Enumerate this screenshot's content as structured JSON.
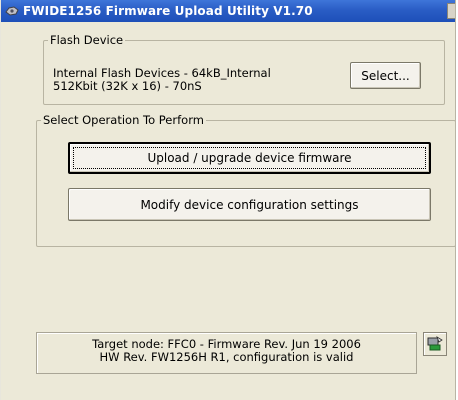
{
  "window": {
    "title": "FWIDE1256 Firmware Upload Utility V1.70"
  },
  "flash_device": {
    "legend": "Flash Device",
    "line1": "Internal Flash Devices - 64kB_Internal",
    "line2": "512Kbit (32K x 16) - 70nS",
    "select_label": "Select..."
  },
  "operations": {
    "legend": "Select Operation To Perform",
    "upload_label": "Upload / upgrade device firmware",
    "modify_label": "Modify device configuration settings"
  },
  "status": {
    "line1": "Target node: FFC0 - Firmware Rev. Jun 19 2006",
    "line2": "HW Rev. FW1256H R1, configuration is valid",
    "icon": "device-status-icon"
  },
  "colors": {
    "titlebar": "#2a5dc5",
    "window_bg": "#ece9d8"
  }
}
